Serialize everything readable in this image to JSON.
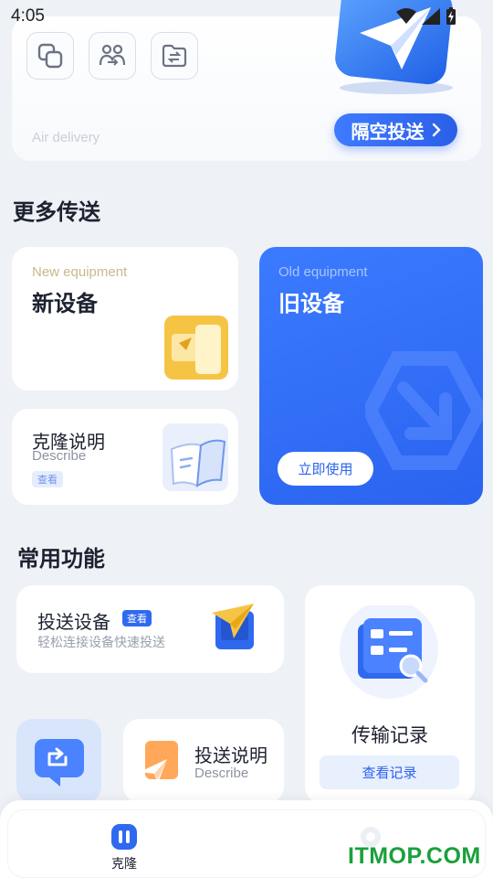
{
  "status": {
    "time": "4:05"
  },
  "air": {
    "subtitle": "Air delivery",
    "button_label": "隔空投送"
  },
  "more_transfer": {
    "title": "更多传送",
    "new_equipment": {
      "subtitle": "New equipment",
      "title": "新设备"
    },
    "old_equipment": {
      "subtitle": "Old equipment",
      "title": "旧设备",
      "button_label": "立即使用"
    },
    "clone_guide": {
      "title": "克隆说明",
      "subtitle": "Describe",
      "tag": "查看"
    }
  },
  "common": {
    "title": "常用功能",
    "cast_device": {
      "title": "投送设备",
      "tag": "查看",
      "subtitle": "轻松连接设备快速投送"
    },
    "transfer_record": {
      "title": "传输记录",
      "button_label": "查看记录"
    },
    "cast_guide": {
      "title": "投送说明",
      "subtitle": "Describe"
    }
  },
  "nav": {
    "clone_label": "克隆"
  },
  "watermark": "ITMOP.COM",
  "colors": {
    "accent": "#2b62ee",
    "yellow": "#f6c445",
    "watermark": "#1aa03c"
  }
}
